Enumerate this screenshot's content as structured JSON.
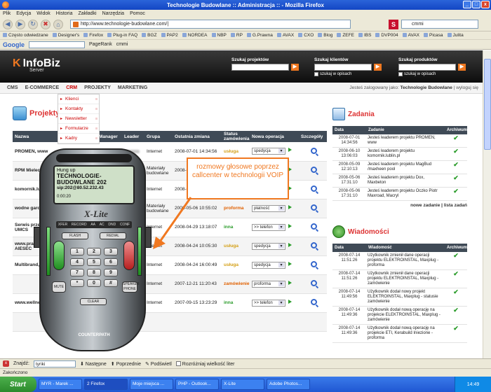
{
  "window": {
    "title": "Technologie Budowlane :: Administracja :: - Mozilla Firefox",
    "controls": [
      "_",
      "□",
      "x"
    ]
  },
  "menu": [
    "Plik",
    "Edycja",
    "Widok",
    "Historia",
    "Zakładki",
    "Narzędzia",
    "Pomoc"
  ],
  "nav": {
    "url": "http://www.technologie-budowlane.com/|",
    "search_value": "cmmi"
  },
  "bookmarks": [
    "Często odwiedzane",
    "Designer's",
    "Firefox",
    "Plug-in FAQ",
    "BGZ",
    "PAP2",
    "NORDEA",
    "NBP",
    "RP",
    "G.Prawna",
    "AVAX",
    "CXO",
    "Blog",
    "ZEFE",
    "IBS",
    "DVP004",
    "AVAX",
    "Picasa",
    "Julita"
  ],
  "googlebar": {
    "logo": "Google",
    "value": "cmmi",
    "pagerank": "PageRank"
  },
  "header": {
    "logo": "InfoBiz",
    "logo_sub": "Server",
    "search_projects": "Szukaj projektów",
    "search_clients": "Szukaj klientów",
    "search_products": "Szukaj produktów",
    "in_notes": "szukaj w opisach"
  },
  "mainnav": [
    "CMS",
    "E-COMMERCE",
    "CRM",
    "PROJEKTY",
    "MARKETING"
  ],
  "logged_in": {
    "prefix": "Jesteś zalogowany jako:",
    "user": "Technologie Budowlane",
    "logout": "wyloguj się"
  },
  "crm_menu": [
    "Klienci",
    "Kontakty",
    "Newsletter",
    "Formularze",
    "Kadry"
  ],
  "projects": {
    "title": "Projekty",
    "columns": [
      "Nazwa",
      "",
      "Manager",
      "Leader",
      "Grupa",
      "Ostatnia zmiana",
      "Status zamówienia",
      "Nowa operacja",
      "Szczegóły"
    ],
    "rows": [
      {
        "name": "PROMEN, www",
        "group": "Internet",
        "date": "2008-07-01 14:34:56",
        "status": "usługa",
        "status_class": "st-usluga",
        "op": "spedycja"
      },
      {
        "name": "RPM Mielec",
        "group": "Materiały budowlane",
        "date": "2008-07-01 14:34:58",
        "status": "usługa",
        "status_class": "st-usluga",
        "op": "spedycja"
      },
      {
        "name": "komornik.lublin.pl",
        "group": "Internet",
        "date": "2008-06-10 13:06:03",
        "status": "usługa",
        "status_class": "st-usluga",
        "op": "spedycja"
      },
      {
        "name": "wodne gardens",
        "group": "Materiały budowlane",
        "date": "2008-05-06 10:55:02",
        "status": "proforma",
        "status_class": "st-proforma",
        "op": "płatność"
      },
      {
        "name": "Serwis przewozowy UMCS",
        "group": "Internet",
        "date": "2008-04-29 13:18:07",
        "status": "inna",
        "status_class": "st-inna",
        "op": ">> telefon"
      },
      {
        "name": "www.pracodawcy AIESEC",
        "group": "Internet",
        "date": "2008-04-24 10:05:30",
        "status": "usługa",
        "status_class": "st-usluga",
        "op": "spedycja"
      },
      {
        "name": "Multibrand, www",
        "group": "Internet",
        "date": "2008-04-24 16:00:49",
        "status": "usługa",
        "status_class": "st-usluga",
        "op": "spedycja"
      },
      {
        "name": "",
        "group": "Internet",
        "date": "2007-12-21 11:20:43",
        "status": "zamówienie",
        "status_class": "st-zam",
        "op": "proforma"
      },
      {
        "name": "www.wellness-spa.biz",
        "group": "Internet",
        "date": "2007-09-15 13:23:29",
        "status": "inna",
        "status_class": "st-inna",
        "op": ">> telefon"
      },
      {
        "name": "",
        "group": "",
        "date": "",
        "status": "",
        "status_class": "",
        "op": ""
      }
    ],
    "extra_texts": [
      "Staszewski",
      "Zdrój-Sauna",
      "Urząd Miasta"
    ]
  },
  "tasks": {
    "title": "Zadania",
    "columns": [
      "Data",
      "Zadanie",
      "Archiwum"
    ],
    "rows": [
      {
        "date": "2008-07-01 14:34:56",
        "text": "Jesteś leaderem projektu PROMEN, www"
      },
      {
        "date": "2008-06-10 13:06:03",
        "text": "Jesteś leaderem projektu komornik.lublin.pl"
      },
      {
        "date": "2008-05-09 12:10:13",
        "text": "Jesteś leaderem projektu MagBud /maxheen pool"
      },
      {
        "date": "2008-05-06 17:31:10",
        "text": "Jesteś leaderem projektu Dox, Maxbeton"
      },
      {
        "date": "2008-05-06 17:31:10",
        "text": "Jesteś leaderem projektu Oczko Piotr Maxroad, Macryl"
      }
    ],
    "new_task": "nowe zadanie",
    "all_tasks": "lista zadań"
  },
  "messages": {
    "title": "Wiadomości",
    "columns": [
      "Data",
      "Wiadomość",
      "Archiwum"
    ],
    "rows": [
      {
        "date": "2008-07-14 11:51:26",
        "text": "Użytkownik zmienił dane operacji projektu ELEKTROINSTAL, Maxplug - proforma"
      },
      {
        "date": "2008-07-14 11:51:26",
        "text": "Użytkownik zmienił dane operacji projektu ELEKTROINSTAL, Maxplug - zamówienie"
      },
      {
        "date": "2008-07-14 11:49:56",
        "text": "Użytkownik dodał nowy projekt ELEKTROINSTAL, Maxplug - statusie zamówienie"
      },
      {
        "date": "2008-07-14 11:49:36",
        "text": "Użytkownik dodał nową operację na projekcie ELEKTROINSTAL, Maxplug - zamówienie"
      },
      {
        "date": "2008-07-14 11:49:36",
        "text": "Użytkownik dodał nową operację na projekcie ETI, Kerabuild Iniezione - proforma"
      }
    ]
  },
  "xlite": {
    "state": "Hung up",
    "name": "TECHNOLOGIE-BUDOWLANE 202",
    "address": "sip:202@80.52.232.43",
    "timer": "0:00:20",
    "brand": "X-Lite",
    "tabs": [
      "XFER",
      "REDIAL",
      "RECORD",
      "AA",
      "AC",
      "DND",
      "CONF"
    ],
    "flash": "FLASH",
    "redial": "REDIAL",
    "keys": [
      "1",
      "2",
      "3",
      "4",
      "5",
      "6",
      "7",
      "8",
      "9",
      "*",
      "0",
      "#"
    ],
    "mute": "MUTE",
    "speaker": "SPEAKER PHONE",
    "clear": "CLEAR",
    "footer": "COUNTERPATH"
  },
  "callout": "rozmowy głosowe poprzez callcenter w technologii VOIP",
  "findbar": {
    "label": "Znajdź:",
    "value": "tyriki",
    "next": "Następne",
    "prev": "Poprzednie",
    "highlight": "Podświetl",
    "match_case": "Rozróżniaj wielkość liter"
  },
  "status": "Zakończono",
  "taskbar": {
    "start": "Start",
    "items": [
      "MYR - Marek ...",
      "2 Firefox",
      "Moje miejsca ...",
      "PHP - Outlook...",
      "X-Lite",
      "Adobe Photos..."
    ],
    "clock": "14:49"
  },
  "colors": {
    "accent": "#f07820",
    "header_dark": "#0d0d0d",
    "table_head": "#3f4a56",
    "crm_red": "#cc0000"
  }
}
